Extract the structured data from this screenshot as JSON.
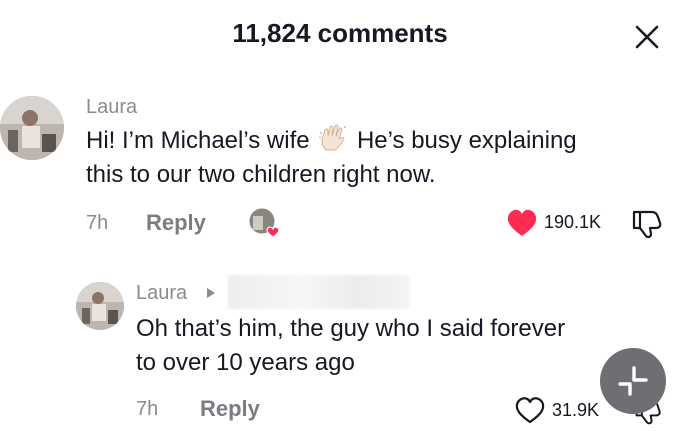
{
  "header": {
    "title": "11,824 comments"
  },
  "comments": [
    {
      "username": "Laura",
      "text_part1": "Hi! I’m Michael’s wife",
      "text_part2": "He’s busy explaining",
      "text_line2": "this to our two children right now.",
      "time": "7h",
      "reply_label": "Reply",
      "like_count": "190.1K",
      "liked": true,
      "accent_color": "#fe2c55"
    }
  ],
  "reply": {
    "username": "Laura",
    "text_line1": "Oh that’s him, the guy who I said forever",
    "text_line2": "to over 10 years ago",
    "time": "7h",
    "reply_label": "Reply",
    "like_count": "31.9K",
    "liked": false
  },
  "icons": {
    "close": "close-icon",
    "wave": "waving-hand-emoji",
    "liked_by_creator": "creator-heart-avatar",
    "like": "heart-icon",
    "dislike": "thumbs-down-icon",
    "collapse": "collapse-icon"
  }
}
